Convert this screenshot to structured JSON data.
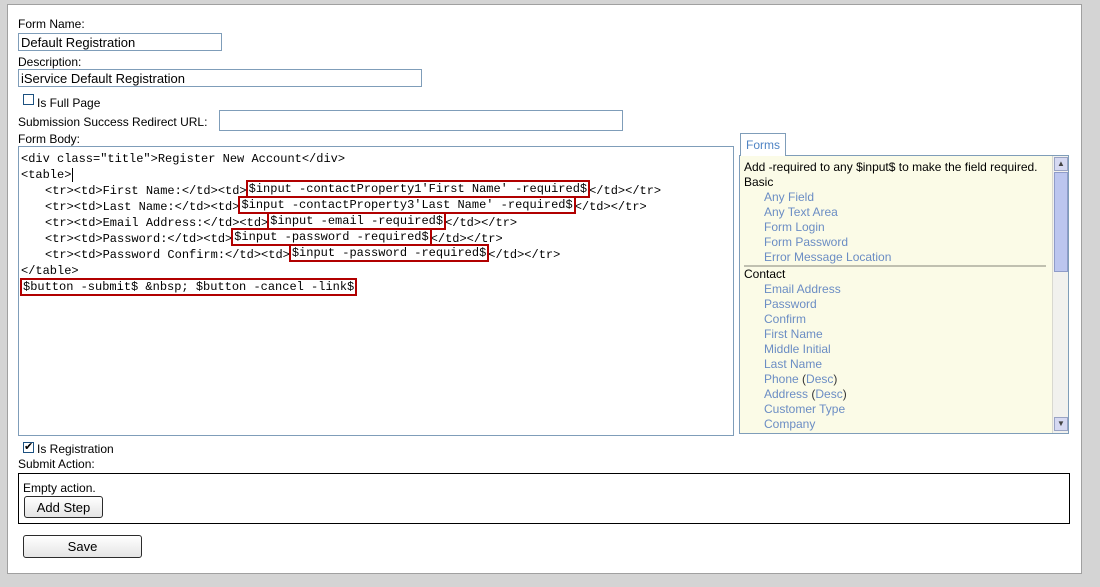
{
  "form": {
    "name_label": "Form Name:",
    "name_value": "Default Registration",
    "description_label": "Description:",
    "description_value": "iService Default Registration",
    "full_page_label": "Is Full Page",
    "full_page_checked": false,
    "redirect_label": "Submission Success Redirect URL:",
    "redirect_value": "",
    "body_label": "Form Body:",
    "is_registration_label": "Is Registration",
    "is_registration_checked": true,
    "submit_action_label": "Submit Action:",
    "empty_action_text": "Empty action.",
    "add_step_label": "Add Step",
    "save_label": "Save"
  },
  "code": {
    "line1": "<div class=\"title\">Register New Account</div>",
    "line2": "<table>",
    "line8": "</table>",
    "rows": [
      {
        "pre": "<tr><td>First Name:</td><td>",
        "tag": "$input -contactProperty1'First Name' -required$",
        "post": "</td></tr>"
      },
      {
        "pre": "<tr><td>Last Name:</td><td>",
        "tag": "$input -contactProperty3'Last Name' -required$",
        "post": "</td></tr>"
      },
      {
        "pre": "<tr><td>Email Address:</td><td>",
        "tag": "$input -email -required$",
        "post": "</td></tr>"
      },
      {
        "pre": "<tr><td>Password:</td><td>",
        "tag": "$input -password -required$",
        "post": "</td></tr>"
      },
      {
        "pre": "<tr><td>Password Confirm:</td><td>",
        "tag": "$input -password -required$",
        "post": "</td></tr>"
      }
    ],
    "buttons_line": "$button -submit$ &nbsp; $button -cancel -link$"
  },
  "panel": {
    "tab_label": "Forms",
    "hint": "Add -required to any $input$ to make the field required.",
    "basic_label": "Basic",
    "basic_items": [
      "Any Field",
      "Any Text Area",
      "Form Login",
      "Form Password",
      "Error Message Location"
    ],
    "contact_label": "Contact",
    "contact_items": [
      "Email Address",
      "Password",
      "Confirm",
      "First Name",
      "Middle Initial",
      "Last Name"
    ],
    "phone": {
      "label": "Phone",
      "desc": "Desc"
    },
    "address": {
      "label": "Address",
      "desc": "Desc"
    },
    "more_items": [
      "Customer Type",
      "Company"
    ]
  },
  "icons": {
    "scroll_up": "scroll-up-arrow-icon",
    "scroll_down": "scroll-down-arrow-icon",
    "checkbox": "checkbox-icon"
  },
  "colors": {
    "highlight_border": "#b10000",
    "link_blue": "#6b8dc4",
    "panel_bg": "#fbfbe7"
  }
}
